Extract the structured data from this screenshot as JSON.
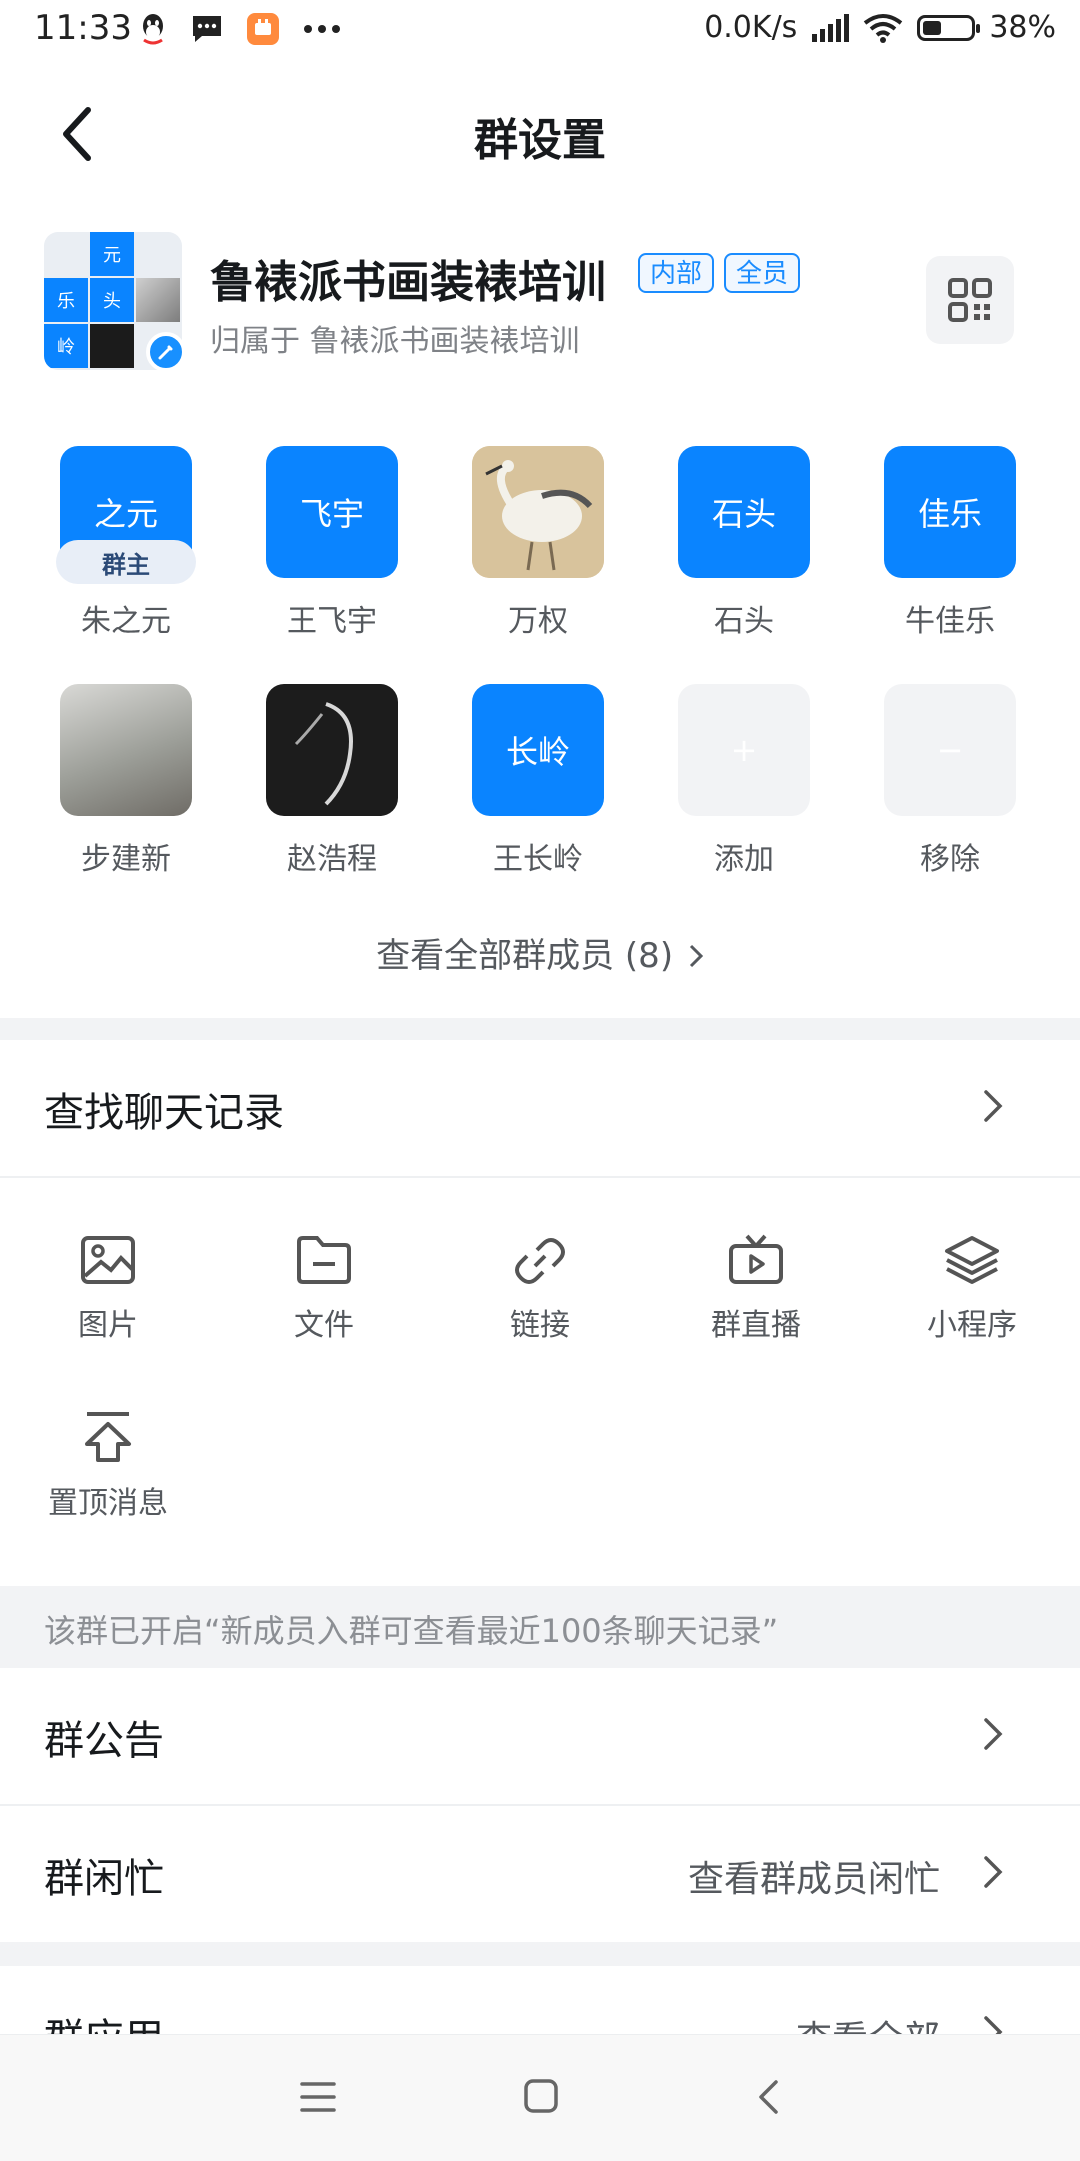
{
  "status_bar": {
    "time": "11:33",
    "speed": "0.0K/s",
    "battery": "38%",
    "left_icons": [
      "qq-icon",
      "message-icon",
      "app-icon",
      "more-dots-icon"
    ],
    "right_icons": [
      "signal-icon",
      "wifi-icon",
      "battery-icon"
    ]
  },
  "nav": {
    "title": "群设置",
    "back_icon": "chevron-left-icon"
  },
  "group": {
    "name": "鲁裱派书画装裱培训",
    "tags": [
      "内部",
      "全员"
    ],
    "belongs_to": "归属于 鲁裱派书画装裱培训",
    "avatar_chars": [
      "元",
      "乐",
      "头",
      "岭"
    ],
    "qr_icon": "qr-code-icon",
    "edit_icon": "pencil-icon"
  },
  "members": [
    {
      "avatar_text": "之元",
      "name": "朱之元",
      "badge": "群主",
      "type": "text"
    },
    {
      "avatar_text": "飞宇",
      "name": "王飞宇",
      "type": "text"
    },
    {
      "avatar_text": "",
      "name": "万权",
      "type": "image-heron"
    },
    {
      "avatar_text": "石头",
      "name": "石头",
      "type": "text"
    },
    {
      "avatar_text": "佳乐",
      "name": "牛佳乐",
      "type": "text"
    },
    {
      "avatar_text": "",
      "name": "步建新",
      "type": "image-landscape"
    },
    {
      "avatar_text": "",
      "name": "赵浩程",
      "type": "image-horse"
    },
    {
      "avatar_text": "长岭",
      "name": "王长岭",
      "type": "text"
    }
  ],
  "member_actions": {
    "add_label": "添加",
    "add_symbol": "+",
    "remove_label": "移除",
    "remove_symbol": "−"
  },
  "view_all": "查看全部群成员 (8)",
  "search_chat": "查找聊天记录",
  "tools": [
    {
      "label": "图片",
      "icon": "image-icon"
    },
    {
      "label": "文件",
      "icon": "folder-icon"
    },
    {
      "label": "链接",
      "icon": "link-icon"
    },
    {
      "label": "群直播",
      "icon": "live-tv-icon"
    },
    {
      "label": "小程序",
      "icon": "layers-icon"
    },
    {
      "label": "置顶消息",
      "icon": "pin-top-icon"
    }
  ],
  "notice": "该群已开启“新成员入群可查看最近100条聊天记录”",
  "announcement": "群公告",
  "busy": {
    "label": "群闲忙",
    "right": "查看群成员闲忙"
  },
  "apps": {
    "label": "群应用",
    "right": "查看全部"
  },
  "system_nav": [
    "menu-icon",
    "home-square-icon",
    "back-icon"
  ]
}
